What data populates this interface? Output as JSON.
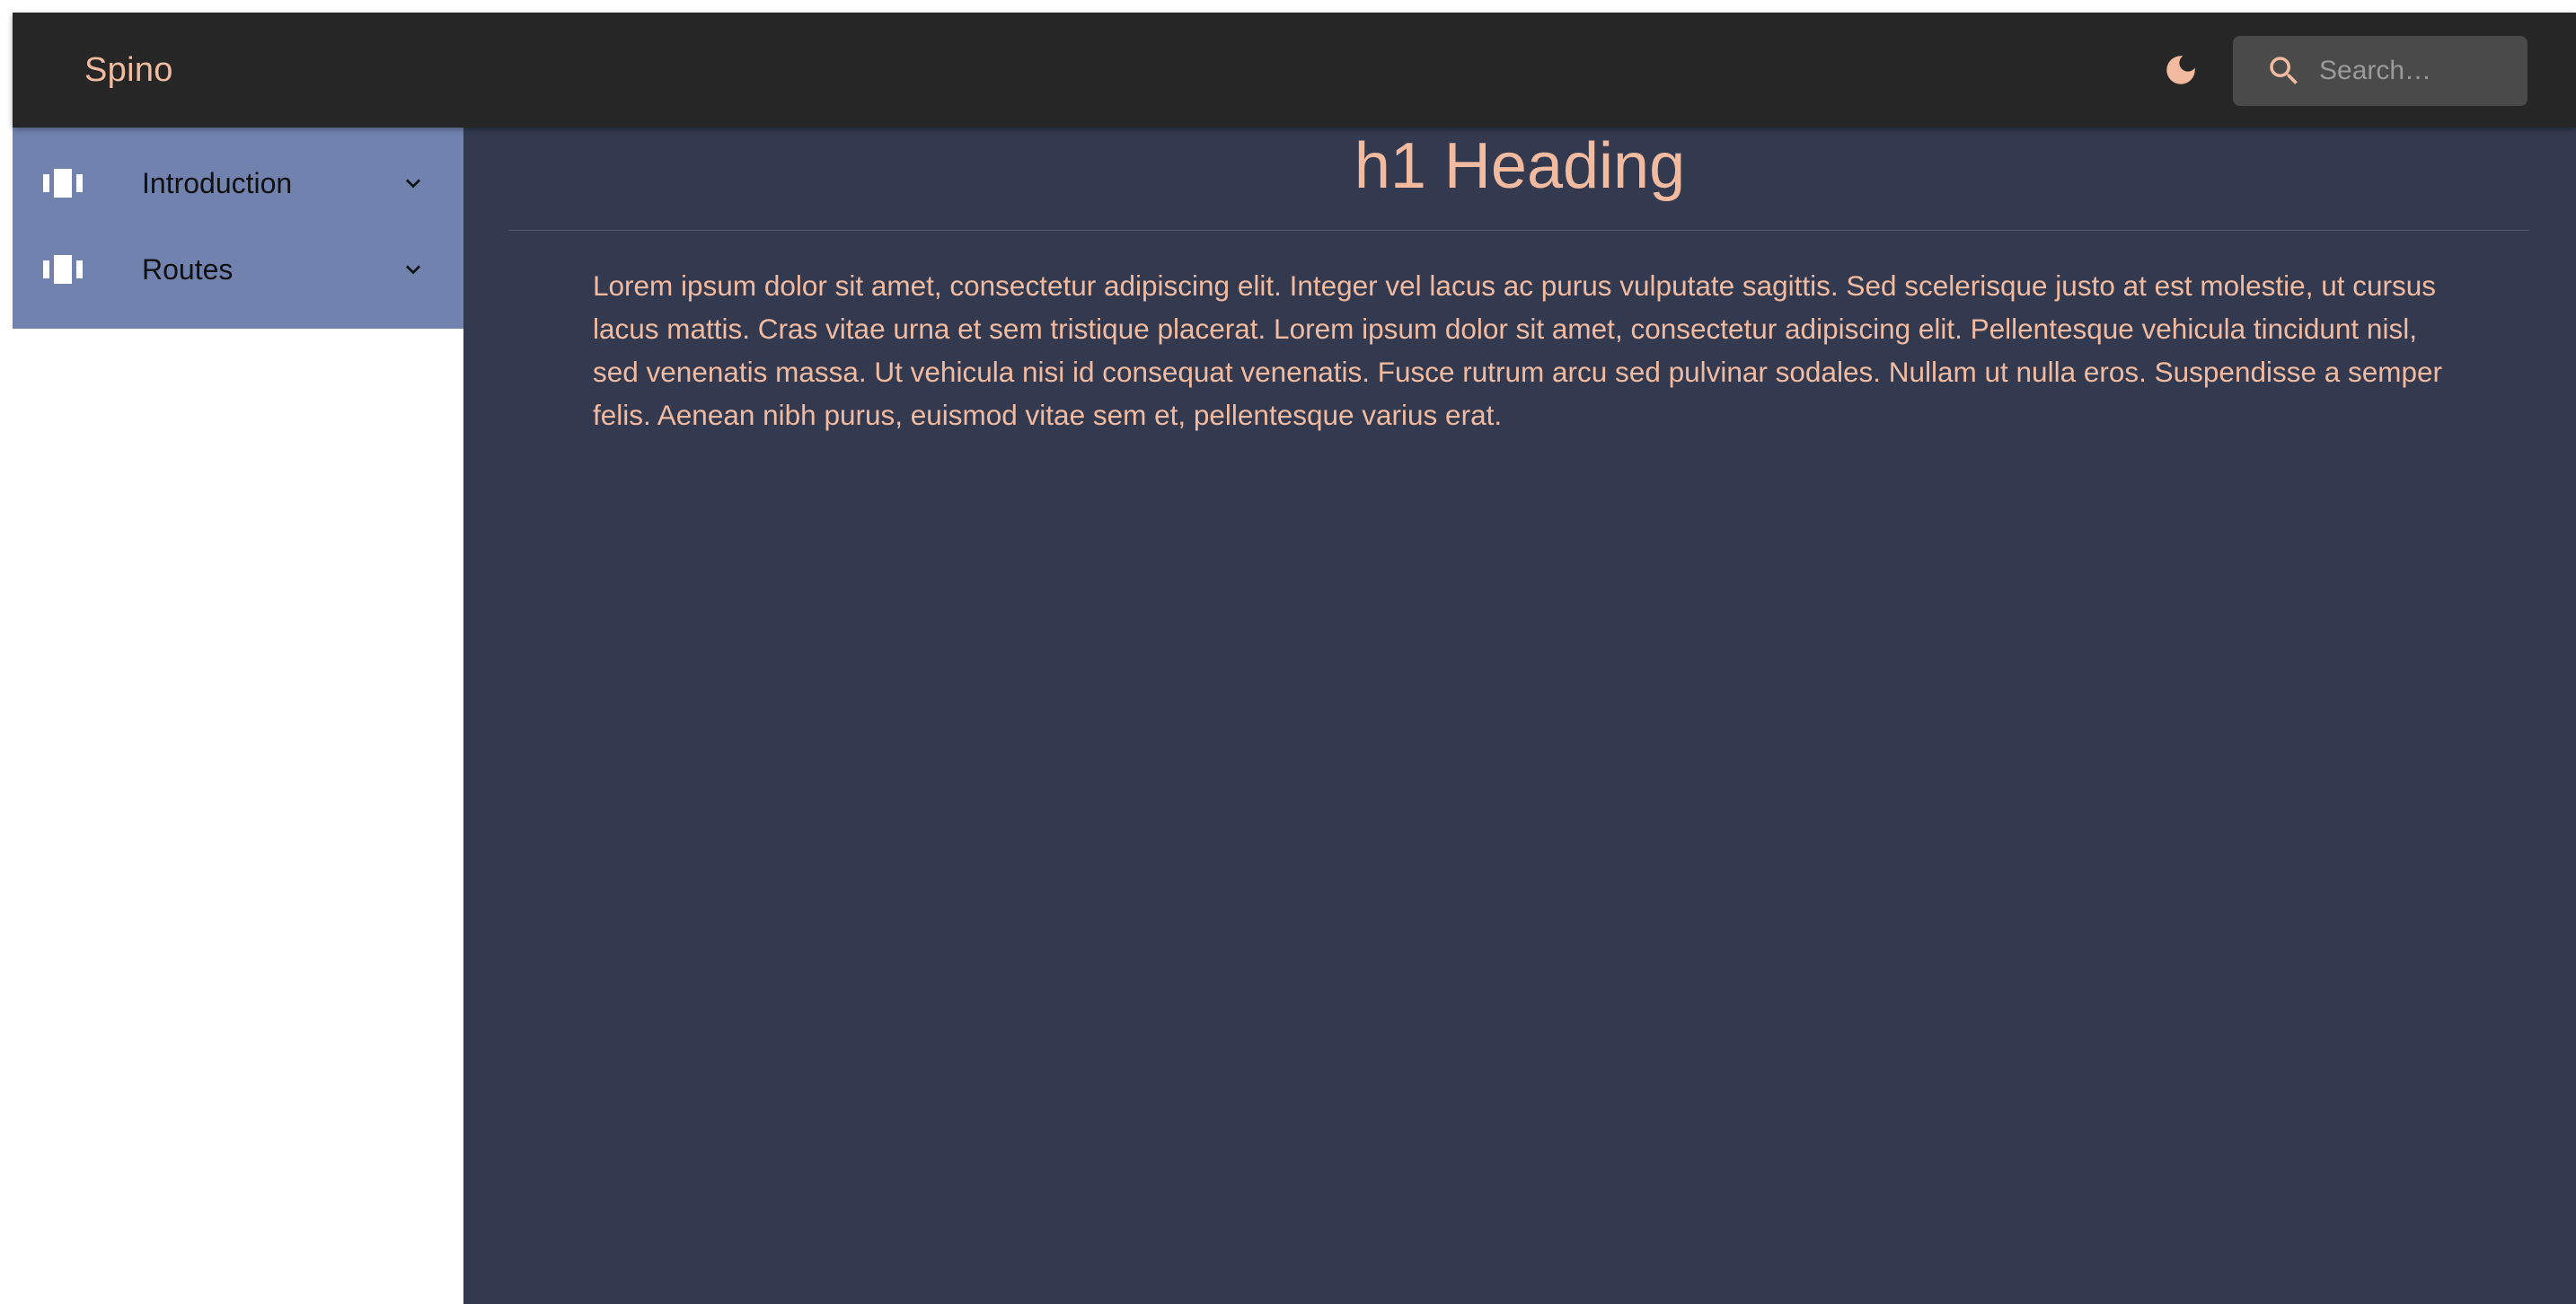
{
  "header": {
    "brand": "Spino",
    "theme_toggle_icon": "moon-icon",
    "search": {
      "placeholder": "Search…",
      "value": ""
    }
  },
  "sidebar": {
    "items": [
      {
        "label": "Introduction",
        "icon": "component-icon",
        "expand_icon": "chevron-down-icon"
      },
      {
        "label": "Routes",
        "icon": "component-icon",
        "expand_icon": "chevron-down-icon"
      }
    ]
  },
  "main": {
    "heading": "h1 Heading",
    "paragraph": "Lorem ipsum dolor sit amet, consectetur adipiscing elit. Integer vel lacus ac purus vulputate sagittis. Sed scelerisque justo at est molestie, ut cursus lacus mattis. Cras vitae urna et sem tristique placerat. Lorem ipsum dolor sit amet, consectetur adipiscing elit. Pellentesque vehicula tincidunt nisl, sed venenatis massa. Ut vehicula nisi id consequat venenatis. Fusce rutrum arcu sed pulvinar sodales. Nullam ut nulla eros. Suspendisse a semper felis. Aenean nibh purus, euismod vitae sem et, pellentesque varius erat."
  },
  "colors": {
    "appbar": "#262626",
    "accent": "#f2bba0",
    "sidebar_nav": "#7282ae",
    "content_background": "#333a50",
    "search_background": "#4a4a4a"
  }
}
